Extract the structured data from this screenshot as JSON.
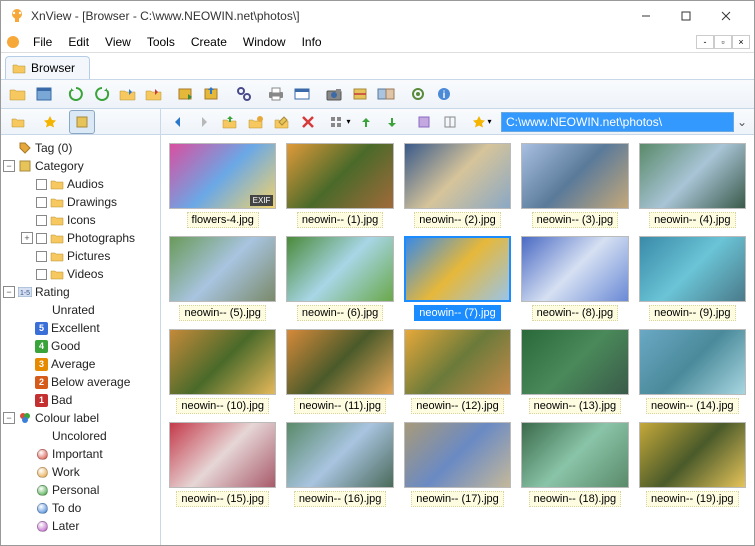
{
  "window": {
    "title": "XnView - [Browser - C:\\www.NEOWIN.net\\photos\\]"
  },
  "menu": [
    "File",
    "Edit",
    "View",
    "Tools",
    "Create",
    "Window",
    "Info"
  ],
  "tab": {
    "label": "Browser"
  },
  "path": "C:\\www.NEOWIN.net\\photos\\",
  "tree": {
    "tag": {
      "label": "Tag (0)"
    },
    "category": {
      "label": "Category",
      "items": [
        "Audios",
        "Drawings",
        "Icons",
        "Photographs",
        "Pictures",
        "Videos"
      ]
    },
    "rating": {
      "label": "Rating",
      "items": [
        {
          "label": "Unrated",
          "badge": ""
        },
        {
          "label": "Excellent",
          "badge": "5",
          "color": "#3a6fd8"
        },
        {
          "label": "Good",
          "badge": "4",
          "color": "#3aa33a"
        },
        {
          "label": "Average",
          "badge": "3",
          "color": "#e68a00"
        },
        {
          "label": "Below average",
          "badge": "2",
          "color": "#d65a1a"
        },
        {
          "label": "Bad",
          "badge": "1",
          "color": "#c43030"
        }
      ]
    },
    "colour": {
      "label": "Colour label",
      "items": [
        {
          "label": "Uncolored",
          "color": ""
        },
        {
          "label": "Important",
          "color": "#d84a3a"
        },
        {
          "label": "Work",
          "color": "#e6a23a"
        },
        {
          "label": "Personal",
          "color": "#3aa33a"
        },
        {
          "label": "To do",
          "color": "#3a7fd8"
        },
        {
          "label": "Later",
          "color": "#b85ac4"
        }
      ]
    }
  },
  "thumbs": [
    {
      "name": "flowers-4.jpg",
      "exif": true,
      "g": [
        "#d94fa0",
        "#6aa8e6",
        "#f2d36b"
      ]
    },
    {
      "name": "neowin-- (1).jpg",
      "g": [
        "#e09a3a",
        "#4a6a2a",
        "#a06a3a"
      ]
    },
    {
      "name": "neowin-- (2).jpg",
      "g": [
        "#3a5a8a",
        "#d6c49a",
        "#8aa8c4"
      ]
    },
    {
      "name": "neowin-- (3).jpg",
      "g": [
        "#a8bfe0",
        "#5a7a9a",
        "#c4a87a"
      ]
    },
    {
      "name": "neowin-- (4).jpg",
      "g": [
        "#5a8a6a",
        "#a8c4d6",
        "#3a5a4a"
      ]
    },
    {
      "name": "neowin-- (5).jpg",
      "g": [
        "#6a9a5a",
        "#a8c4e0",
        "#7a8a6a"
      ]
    },
    {
      "name": "neowin-- (6).jpg",
      "g": [
        "#4a8a3a",
        "#a8d6e6",
        "#6aa84a"
      ]
    },
    {
      "name": "neowin-- (7).jpg",
      "sel": true,
      "g": [
        "#3a8ae6",
        "#e6b83a",
        "#9ac4e6"
      ]
    },
    {
      "name": "neowin-- (8).jpg",
      "g": [
        "#4a6ac4",
        "#d6e0f2",
        "#6a8ad6"
      ]
    },
    {
      "name": "neowin-- (9).jpg",
      "g": [
        "#3a8aa8",
        "#6ac4d6",
        "#4a7a8a"
      ]
    },
    {
      "name": "neowin-- (10).jpg",
      "g": [
        "#c48a3a",
        "#4a6a2a",
        "#e6b85a"
      ]
    },
    {
      "name": "neowin-- (11).jpg",
      "g": [
        "#d68a3a",
        "#4a5a2a",
        "#e6a85a"
      ]
    },
    {
      "name": "neowin-- (12).jpg",
      "g": [
        "#e6a83a",
        "#6a7a3a",
        "#c48a4a"
      ]
    },
    {
      "name": "neowin-- (13).jpg",
      "g": [
        "#2a6a3a",
        "#4a8a5a",
        "#3a5a4a"
      ]
    },
    {
      "name": "neowin-- (14).jpg",
      "g": [
        "#6aa8c4",
        "#4a8a9a",
        "#a8d6e0"
      ]
    },
    {
      "name": "neowin-- (15).jpg",
      "g": [
        "#c43a4a",
        "#e6d6d6",
        "#a85a6a"
      ]
    },
    {
      "name": "neowin-- (16).jpg",
      "g": [
        "#5a8a6a",
        "#a8c4e0",
        "#4a6a5a"
      ]
    },
    {
      "name": "neowin-- (17).jpg",
      "g": [
        "#a89a7a",
        "#6a8ac4",
        "#c4b89a"
      ]
    },
    {
      "name": "neowin-- (18).jpg",
      "g": [
        "#3a6a4a",
        "#8ac4a8",
        "#5a8a6a"
      ]
    },
    {
      "name": "neowin-- (19).jpg",
      "g": [
        "#c4a83a",
        "#4a5a2a",
        "#e6c45a"
      ]
    }
  ]
}
